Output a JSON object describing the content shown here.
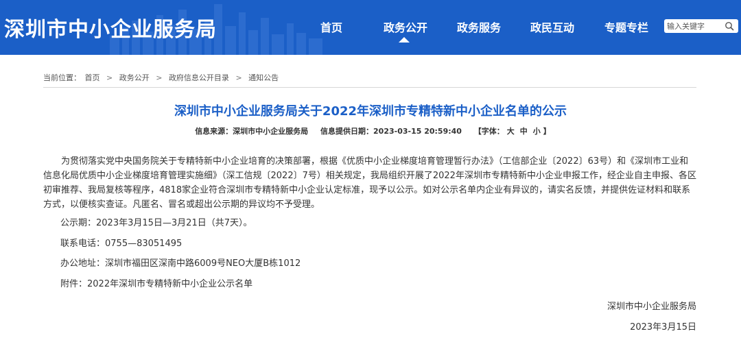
{
  "header": {
    "site_title": "深圳市中小企业服务局",
    "nav": [
      "首页",
      "政务公开",
      "政务服务",
      "政民互动",
      "专题专栏"
    ],
    "active_nav": "政务公开",
    "search_placeholder": "输入关键字",
    "brand_color": "#1b5fc7"
  },
  "breadcrumb": {
    "label": "当前位置：",
    "items": [
      "首页",
      "政务公开",
      "政府信息公开目录",
      "通知公告"
    ],
    "separator": ">"
  },
  "article": {
    "title": "深圳市中小企业服务局关于2022年深圳市专精特新中小企业名单的公示",
    "source": "信息来源：深圳市中小企业服务局",
    "date": "信息提供日期：2023-03-15 20:59:40",
    "font_label": "【字体：",
    "font_sizes": [
      "大",
      "中",
      "小"
    ],
    "font_close": "】",
    "body": "为贯彻落实党中央国务院关于专精特新中小企业培育的决策部署，根据《优质中小企业梯度培育管理暂行办法》（工信部企业〔2022〕63号）和《深圳市工业和信息化局优质中小企业梯度培育管理实施细》（深工信规〔2022〕7号）相关规定，我局组织开展了2022年深圳市专精特新中小企业申报工作，经企业自主申报、各区初审推荐、我局复核等程序，4818家企业符合深圳市专精特新中小企业认定标准，现予以公示。如对公示名单内企业有异议的，请实名反馈，并提供佐证材料和联系方式，以便核实查证。凡匿名、冒名或超出公示期的异议均不予受理。",
    "period": "公示期：2023年3月15日—3月21日（共7天）。",
    "phone": "联系电话：0755—83051495",
    "address": "办公地址：深圳市福田区深南中路6009号NEO大厦B栋1012",
    "attachment": "附件：2022年深圳市专精特新中小企业公示名单",
    "signature": "深圳市中小企业服务局",
    "sign_date": "2023年3月15日"
  },
  "colors": {
    "header_bg": "#1b5fc7",
    "title_blue": "#1b5fc7",
    "text": "#333333"
  }
}
